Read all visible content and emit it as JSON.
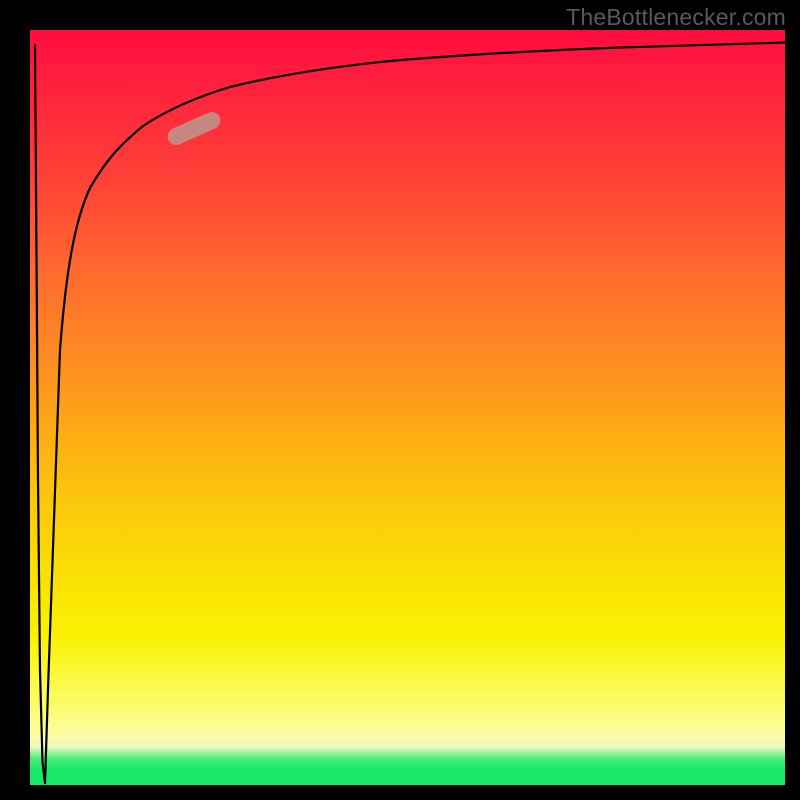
{
  "attribution": "TheBottlenecker.com",
  "chart_data": {
    "type": "line",
    "title": "",
    "xlabel": "",
    "ylabel": "",
    "xlim": [
      0,
      100
    ],
    "ylim": [
      0,
      100
    ],
    "grid": false,
    "legend": false,
    "background_gradient": {
      "direction": "vertical",
      "stops": [
        {
          "pct": 0,
          "color": "#ff0c3e"
        },
        {
          "pct": 20,
          "color": "#ff4236"
        },
        {
          "pct": 45,
          "color": "#fd9020"
        },
        {
          "pct": 70,
          "color": "#fadb05"
        },
        {
          "pct": 88,
          "color": "#fbfb59"
        },
        {
          "pct": 94,
          "color": "#fcfca6"
        },
        {
          "pct": 97,
          "color": "#19e866"
        },
        {
          "pct": 100,
          "color": "#19e866"
        }
      ]
    },
    "series": [
      {
        "name": "descending-spike",
        "color": "#000000",
        "x": [
          0.7,
          0.9,
          1.1,
          1.3,
          1.6,
          2.0
        ],
        "y": [
          98,
          70,
          40,
          15,
          3,
          0
        ]
      },
      {
        "name": "rising-saturation-curve",
        "color": "#000000",
        "x": [
          2.0,
          3,
          4,
          5,
          6,
          8,
          10,
          12,
          15,
          20,
          25,
          30,
          40,
          50,
          60,
          70,
          80,
          90,
          100
        ],
        "y": [
          0,
          40,
          58,
          67,
          73,
          79,
          83,
          85.5,
          88,
          90.3,
          91.8,
          92.9,
          94.3,
          95.2,
          95.9,
          96.4,
          96.8,
          97.1,
          97.4
        ]
      }
    ],
    "highlight_segment": {
      "start": {
        "x": 16,
        "y": 89
      },
      "end": {
        "x": 23,
        "y": 91.2
      },
      "color": "#c38c85"
    }
  }
}
